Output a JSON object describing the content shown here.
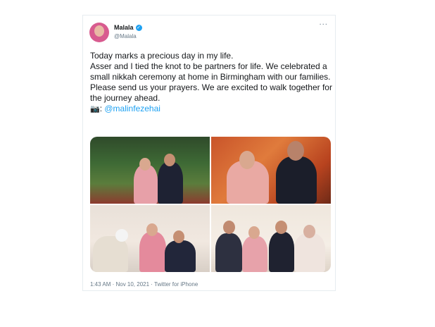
{
  "tweet": {
    "display_name": "Malala",
    "handle": "@Malala",
    "more_icon": "···",
    "paragraphs": [
      "Today marks a precious day in my life.",
      "Asser and I tied the knot to be partners for life. We celebrated a small nikkah ceremony at home in Birmingham with our families. Please send us your prayers. We are excited to walk together for the journey ahead."
    ],
    "camera_emoji": "📷",
    "credit_separator": ": ",
    "credit_mention": "@malinfezehai",
    "meta": "1:43 AM · Nov 10, 2021 · Twitter for iPhone"
  },
  "colors": {
    "link": "#1da1f2",
    "verified": "#1da1f2",
    "text": "#14171a",
    "secondary": "#657786"
  }
}
